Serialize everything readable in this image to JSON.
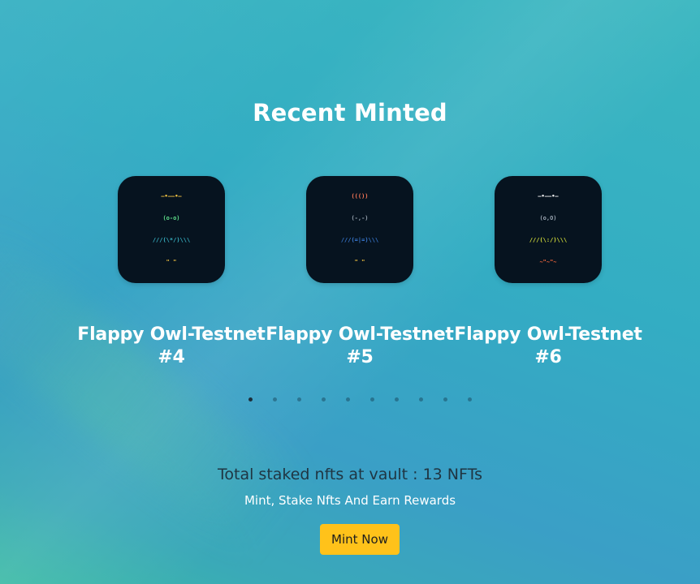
{
  "section": {
    "title": "Recent Minted"
  },
  "cards": [
    {
      "name": "Flappy Owl-Testnet #4",
      "art": [
        {
          "text": "—•——•—",
          "color": "#f5c542"
        },
        {
          "text": "(o-o)",
          "color": "#5ee08a"
        },
        {
          "text": "///(\\*/)\\\\\\",
          "color": "#39b7c9"
        },
        {
          "text": "\" \"",
          "color": "#f5c542"
        }
      ]
    },
    {
      "name": "Flappy Owl-Testnet #5",
      "art": [
        {
          "text": "((())",
          "color": "#ff7a59"
        },
        {
          "text": "(-,-)",
          "color": "#9aa6b2"
        },
        {
          "text": "///(=|=)\\\\\\",
          "color": "#3a7bd5"
        },
        {
          "text": "\" \"",
          "color": "#f5c542"
        }
      ]
    },
    {
      "name": "Flappy Owl-Testnet #6",
      "art": [
        {
          "text": "—•——•—",
          "color": "#f5f5f5"
        },
        {
          "text": "(o,O)",
          "color": "#9aa6b2"
        },
        {
          "text": "///(\\:/)\\\\\\",
          "color": "#d6e13a"
        },
        {
          "text": "~\"~\"~",
          "color": "#ff6a3d"
        }
      ]
    }
  ],
  "carousel": {
    "dot_count": 10,
    "active_index": 0
  },
  "footer": {
    "staked_text": "Total staked nfts at vault : 13 NFTs",
    "tagline": "Mint, Stake Nfts And Earn Rewards",
    "mint_button": "Mint Now"
  }
}
